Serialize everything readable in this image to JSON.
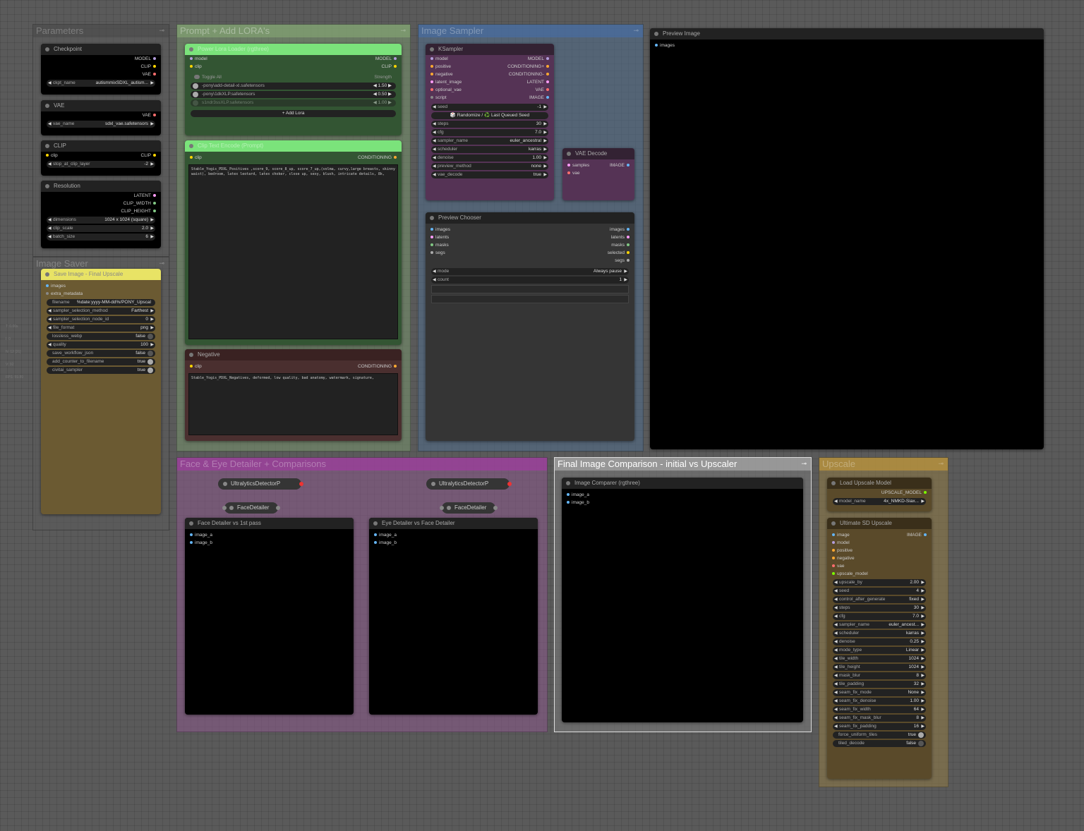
{
  "side_info": [
    "T: 0.00s",
    "I: 0",
    "N: 12 [21]",
    "V: 92",
    "FPS: 59.89"
  ],
  "groups": {
    "parameters": "Parameters",
    "image_saver": "Image Saver",
    "prompt": "Prompt + Add LORA's",
    "image_sampler": "Image Sampler",
    "detailer": "Face & Eye Detailer + Comparisons",
    "final": "Final Image Comparison - initial vs Upscaler",
    "upscale": "Upscale"
  },
  "checkpoint": {
    "title": "Checkpoint",
    "outputs": [
      "MODEL",
      "CLIP",
      "VAE"
    ],
    "ckpt_label": "ckpt_name",
    "ckpt_value": "autismmixSDXL_autism..."
  },
  "vae": {
    "title": "VAE",
    "output": "VAE",
    "label": "vae_name",
    "value": "sdxl_vae.safetensors"
  },
  "clip": {
    "title": "CLIP",
    "input": "clip",
    "output": "CLIP",
    "label": "stop_at_clip_layer",
    "value": "-2"
  },
  "resolution": {
    "title": "Resolution",
    "outputs": [
      "LATENT",
      "CLIP_WIDTH",
      "CLIP_HEIGHT"
    ],
    "widgets": [
      {
        "label": "dimensions",
        "value": "1024 x 1024 (square)"
      },
      {
        "label": "clip_scale",
        "value": "2.0"
      },
      {
        "label": "batch_size",
        "value": "6"
      }
    ]
  },
  "save_image": {
    "title": "Save Image - Final Upscale",
    "inputs": [
      "images",
      "extra_metadata"
    ],
    "filename_label": "filename",
    "filename_value": "%date:yyyy-MM-dd%/PONY_Upscal",
    "widgets": [
      {
        "label": "sampler_selection_method",
        "value": "Farthest"
      },
      {
        "label": "sampler_selection_node_id",
        "value": "0"
      },
      {
        "label": "file_format",
        "value": "png"
      },
      {
        "label": "lossless_webp",
        "value": "false",
        "toggle": true,
        "on": false
      },
      {
        "label": "quality",
        "value": "100"
      },
      {
        "label": "save_workflow_json",
        "value": "false",
        "toggle": true,
        "on": false
      },
      {
        "label": "add_counter_to_filename",
        "value": "true",
        "toggle": true,
        "on": true
      },
      {
        "label": "civitai_sampler",
        "value": "true",
        "toggle": true,
        "on": true
      }
    ]
  },
  "lora": {
    "title": "Power Lora Loader (rgthree)",
    "in_model": "model",
    "in_clip": "clip",
    "out_model": "MODEL",
    "out_clip": "CLIP",
    "toggle_all": "Toggle All",
    "strength": "Strength",
    "loras": [
      {
        "name": "-pony\\add-detail-xl.safetensors",
        "value": "1.50",
        "on": true
      },
      {
        "name": "-pony\\1dkXLP.safetensors",
        "value": "0.50",
        "on": true
      },
      {
        "name": "s1ndr3ssXLP.safetensors",
        "value": "1.00",
        "on": false
      }
    ],
    "add_lora": "+ Add Lora"
  },
  "positive": {
    "title": "Clip Text Encode (Prompt)",
    "input": "clip",
    "output": "CONDITIONING",
    "text": "Stable_Yogis_PDXL_Positives ,score_9, score_8_up, score_7_up,(volma, curvy,large breasts, skinny waist), bedroom, latex leotard, latex choker, close up, sexy, blush, intricate details, 8k,"
  },
  "negative": {
    "title": "Negative",
    "input": "clip",
    "output": "CONDITIONING",
    "text": "Stable_Yogis_PDXL_Negatives, deformed, low quality, bad anatomy, watermark, signature,"
  },
  "ksampler": {
    "title": "KSampler",
    "io": [
      {
        "in": "model",
        "out": "MODEL",
        "in_color": "#b39ddb",
        "out_color": "#b39ddb"
      },
      {
        "in": "positive",
        "out": "CONDITIONING+",
        "in_color": "#ffa931",
        "out_color": "#ffa931"
      },
      {
        "in": "negative",
        "out": "CONDITIONING-",
        "in_color": "#ffa931",
        "out_color": "#ffa931"
      },
      {
        "in": "latent_image",
        "out": "LATENT",
        "in_color": "#ff9cf9",
        "out_color": "#ff9cf9"
      },
      {
        "in": "optional_vae",
        "out": "VAE",
        "in_color": "#ff6e6e",
        "out_color": "#ff6e6e"
      },
      {
        "in": "script",
        "out": "IMAGE",
        "in_color": "#888888",
        "out_color": "#64b5f6"
      }
    ],
    "seed_label": "seed",
    "seed_value": "-1",
    "randomize": "🎲 Randomize / ♻️ Last Queued Seed",
    "widgets": [
      {
        "label": "steps",
        "value": "30"
      },
      {
        "label": "cfg",
        "value": "7.0"
      },
      {
        "label": "sampler_name",
        "value": "euler_ancestral"
      },
      {
        "label": "scheduler",
        "value": "karras"
      },
      {
        "label": "denoise",
        "value": "1.00"
      },
      {
        "label": "preview_method",
        "value": "none"
      },
      {
        "label": "vae_decode",
        "value": "true"
      }
    ]
  },
  "vae_decode": {
    "title": "VAE Decode",
    "inputs": [
      "samples",
      "vae"
    ],
    "output": "IMAGE"
  },
  "preview_chooser": {
    "title": "Preview Chooser",
    "io": [
      {
        "in": "images",
        "out": "images"
      },
      {
        "in": "latents",
        "out": "latents"
      },
      {
        "in": "masks",
        "out": "masks"
      },
      {
        "in": "segs",
        "out": "selected"
      },
      {
        "in": "",
        "out": "segs"
      }
    ],
    "mode_label": "mode",
    "mode_value": "Always pause",
    "count_label": "count",
    "count_value": "1"
  },
  "preview_image": {
    "title": "Preview Image",
    "input": "images"
  },
  "detailer": {
    "ultra1": "UltralyticsDetectorP",
    "ultra2": "UltralyticsDetectorP",
    "face1": "FaceDetailer",
    "face2": "FaceDetailer",
    "comp1_title": "Face Detailer vs 1st pass",
    "comp2_title": "Eye Detailer vs Face Detailer",
    "image_a": "image_a",
    "image_b": "image_b"
  },
  "final_comp": {
    "title": "Image Comparer (rgthree)",
    "image_a": "image_a",
    "image_b": "image_b"
  },
  "load_upscale": {
    "title": "Load Upscale Model",
    "output": "UPSCALE_MODEL",
    "label": "model_name",
    "value": "4x_NMKD-Siax..."
  },
  "ultimate": {
    "title": "Ultimate SD Upscale",
    "output": "IMAGE",
    "inputs": [
      {
        "name": "image",
        "color": "#64b5f6"
      },
      {
        "name": "model",
        "color": "#b39ddb"
      },
      {
        "name": "positive",
        "color": "#ffa931"
      },
      {
        "name": "negative",
        "color": "#ffa931"
      },
      {
        "name": "vae",
        "color": "#ff6e6e"
      },
      {
        "name": "upscale_model",
        "color": "#7cfc00"
      }
    ],
    "widgets": [
      {
        "label": "upscale_by",
        "value": "2.00"
      },
      {
        "label": "seed",
        "value": "4"
      },
      {
        "label": "control_after_generate",
        "value": "fixed"
      },
      {
        "label": "steps",
        "value": "30"
      },
      {
        "label": "cfg",
        "value": "7.0"
      },
      {
        "label": "sampler_name",
        "value": "euler_ancest..."
      },
      {
        "label": "scheduler",
        "value": "karras"
      },
      {
        "label": "denoise",
        "value": "0.25"
      },
      {
        "label": "mode_type",
        "value": "Linear"
      },
      {
        "label": "tile_width",
        "value": "1024"
      },
      {
        "label": "tile_height",
        "value": "1024"
      },
      {
        "label": "mask_blur",
        "value": "8"
      },
      {
        "label": "tile_padding",
        "value": "32"
      },
      {
        "label": "seam_fix_mode",
        "value": "None"
      },
      {
        "label": "seam_fix_denoise",
        "value": "1.00"
      },
      {
        "label": "seam_fix_width",
        "value": "64"
      },
      {
        "label": "seam_fix_mask_blur",
        "value": "8"
      },
      {
        "label": "seam_fix_padding",
        "value": "16"
      },
      {
        "label": "force_uniform_tiles",
        "value": "true",
        "toggle": true,
        "on": true
      },
      {
        "label": "tiled_decode",
        "value": "false",
        "toggle": true,
        "on": false
      }
    ]
  },
  "colors": {
    "slot_model": "#b39ddb",
    "slot_clip": "#ffd500",
    "slot_vae": "#ff6e6e",
    "slot_conditioning": "#ffa931",
    "slot_latent": "#ff9cf9",
    "slot_image": "#64b5f6",
    "slot_upscale": "#7cfc00",
    "slot_mask": "#81c784"
  }
}
